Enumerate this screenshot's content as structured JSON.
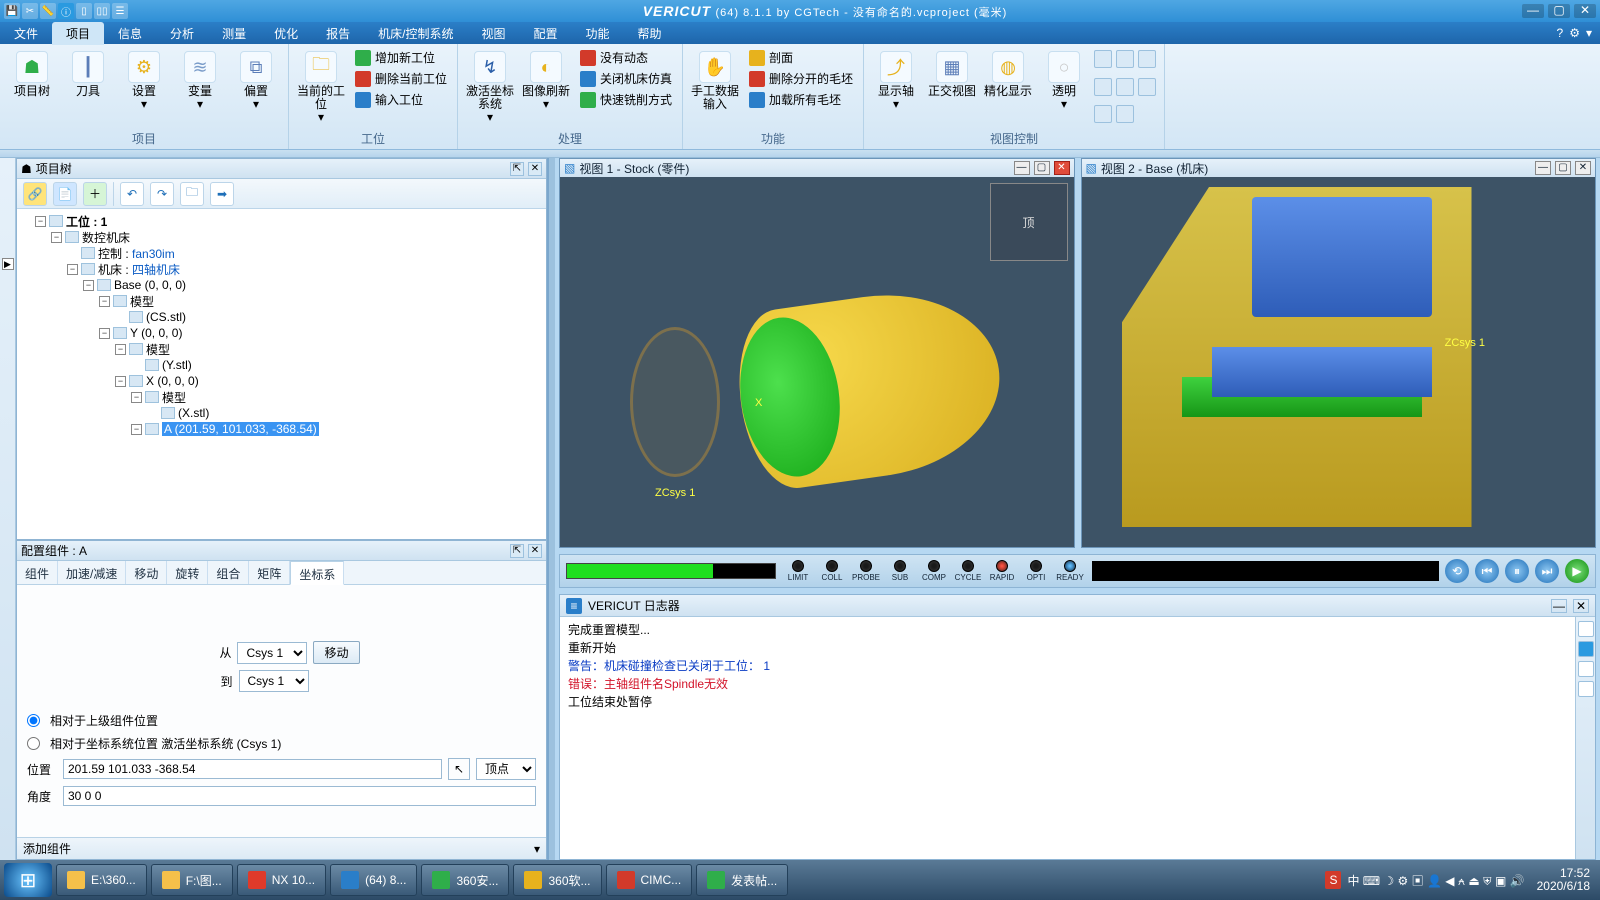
{
  "title": {
    "brand": "VERICUT",
    "suffix": "(64)  8.1.1 by CGTech - 没有命名的.vcproject (毫米)"
  },
  "menus": [
    "文件",
    "项目",
    "信息",
    "分析",
    "测量",
    "优化",
    "报告",
    "机床/控制系统",
    "视图",
    "配置",
    "功能",
    "帮助"
  ],
  "menu_active_index": 1,
  "ribbon": {
    "groups": [
      {
        "label": "项目",
        "big": [
          {
            "name": "project-tree",
            "label": "项目树",
            "icon": "☗",
            "color": "#2fae4a"
          },
          {
            "name": "tool",
            "label": "刀具",
            "icon": "┃",
            "color": "#5b7db8"
          },
          {
            "name": "setup",
            "label": "设置",
            "icon": "⚙",
            "color": "#e7b21d",
            "drop": true
          },
          {
            "name": "variable",
            "label": "变量",
            "icon": "≋",
            "color": "#7a9cc9",
            "drop": true
          },
          {
            "name": "offset",
            "label": "偏置",
            "icon": "⧉",
            "color": "#5b7db8",
            "drop": true
          }
        ]
      },
      {
        "label": "工位",
        "big": [
          {
            "name": "current-setup",
            "label": "当前的工位",
            "icon": "🗀",
            "color": "#e7b21d",
            "drop": true
          }
        ],
        "small": [
          {
            "name": "add-setup",
            "label": "增加新工位",
            "icon": "#2fae4a"
          },
          {
            "name": "del-setup",
            "label": "删除当前工位",
            "icon": "#d23a2a"
          },
          {
            "name": "import-setup",
            "label": "输入工位",
            "icon": "#2a7ec9"
          }
        ]
      },
      {
        "label": "处理",
        "big": [
          {
            "name": "activate-csys",
            "label": "激活坐标系统",
            "icon": "↯",
            "color": "#2a5ea8",
            "drop": true
          },
          {
            "name": "image-refresh",
            "label": "图像刷新",
            "icon": "◐",
            "color": "#e7b21d",
            "drop": true
          }
        ],
        "small": [
          {
            "name": "no-anim",
            "label": "没有动态",
            "icon": "#d23a2a"
          },
          {
            "name": "close-sim",
            "label": "关闭机床仿真",
            "icon": "#2a7ec9"
          },
          {
            "name": "fast-mill",
            "label": "快速铣削方式",
            "icon": "#2fae4a"
          }
        ]
      },
      {
        "label": "功能",
        "big": [
          {
            "name": "manual-input",
            "label": "手工数据输入",
            "icon": "✋",
            "color": "#e08a1d"
          }
        ],
        "small": [
          {
            "name": "section",
            "label": "剖面",
            "icon": "#e7b21d"
          },
          {
            "name": "del-split",
            "label": "删除分开的毛坯",
            "icon": "#d23a2a"
          },
          {
            "name": "load-all",
            "label": "加载所有毛坯",
            "icon": "#2a7ec9"
          }
        ]
      },
      {
        "label": "视图控制",
        "big": [
          {
            "name": "show-axis",
            "label": "显示轴",
            "icon": "⤴",
            "color": "#e7b21d",
            "drop": true
          },
          {
            "name": "ortho",
            "label": "正交视图",
            "icon": "▦",
            "color": "#5b7db8"
          },
          {
            "name": "refine",
            "label": "精化显示",
            "icon": "◍",
            "color": "#e7b21d"
          },
          {
            "name": "transparent",
            "label": "透明",
            "icon": "○",
            "color": "#c8c8c8",
            "drop": true
          }
        ],
        "grid": 8
      }
    ]
  },
  "project_tree": {
    "title": "项目树",
    "nodes": [
      {
        "ind": 1,
        "exp": "−",
        "text": "工位 : 1",
        "bold": true
      },
      {
        "ind": 2,
        "exp": "−",
        "text": "数控机床"
      },
      {
        "ind": 3,
        "exp": "",
        "text": "控制 : ",
        "link": "fan30im"
      },
      {
        "ind": 3,
        "exp": "−",
        "text": "机床 : ",
        "link": "四轴机床"
      },
      {
        "ind": 4,
        "exp": "−",
        "text": "Base (0, 0, 0)"
      },
      {
        "ind": 5,
        "exp": "−",
        "text": "模型"
      },
      {
        "ind": 6,
        "exp": "",
        "text": "(CS.stl)"
      },
      {
        "ind": 5,
        "exp": "−",
        "text": "Y (0, 0, 0)"
      },
      {
        "ind": 6,
        "exp": "−",
        "text": "模型"
      },
      {
        "ind": 7,
        "exp": "",
        "text": "(Y.stl)"
      },
      {
        "ind": 6,
        "exp": "−",
        "text": "X (0, 0, 0)"
      },
      {
        "ind": 7,
        "exp": "−",
        "text": "模型"
      },
      {
        "ind": 8,
        "exp": "",
        "text": "(X.stl)"
      },
      {
        "ind": 7,
        "exp": "−",
        "text": "A (201.59, 101.033, -368.54)",
        "sel": true
      }
    ]
  },
  "config": {
    "title": "配置组件 : A",
    "tabs": [
      "组件",
      "加速/减速",
      "移动",
      "旋转",
      "组合",
      "矩阵",
      "坐标系"
    ],
    "active_tab": 6,
    "from_label": "从",
    "to_label": "到",
    "csys_from": "Csys 1",
    "csys_to": "Csys 1",
    "move_btn": "移动",
    "radio1": "相对于上级组件位置",
    "radio2": "相对于坐标系统位置 激活坐标系统 (Csys 1)",
    "pos_label": "位置",
    "pos_value": "201.59 101.033 -368.54",
    "vertex_label": "顶点",
    "ang_label": "角度",
    "ang_value": "30 0 0",
    "add_label": "添加组件"
  },
  "views": {
    "v1": {
      "title": "视图 1 - Stock (零件)",
      "axis1": "X",
      "axis2": "ZCsys 1",
      "compass": "顶"
    },
    "v2": {
      "title": "视图 2 - Base (机床)",
      "axis": "ZCsys 1"
    }
  },
  "leds": [
    "LIMIT",
    "COLL",
    "PROBE",
    "SUB",
    "COMP",
    "CYCLE",
    "RAPID",
    "OPTI",
    "READY"
  ],
  "log": {
    "title": "VERICUT 日志器",
    "lines": [
      {
        "text": "完成重置模型...",
        "color": "#000"
      },
      {
        "text": "重新开始",
        "color": "#000"
      },
      {
        "text": "警告：机床碰撞检查已关闭于工位： 1",
        "color": "#0a3cc4"
      },
      {
        "text": "错误：主轴组件名Spindle无效",
        "color": "#d2142a"
      },
      {
        "text": "工位结束处暂停",
        "color": "#000"
      }
    ]
  },
  "taskbar": {
    "items": [
      {
        "label": "E:\\360...",
        "color": "#f5c04a"
      },
      {
        "label": "F:\\图...",
        "color": "#f5c04a"
      },
      {
        "label": "NX 10...",
        "color": "#e03a2a"
      },
      {
        "label": "(64)  8...",
        "color": "#2a7ec9"
      },
      {
        "label": "360安...",
        "color": "#2fae4a"
      },
      {
        "label": "360软...",
        "color": "#e7b21d"
      },
      {
        "label": "CIMC...",
        "color": "#d23a2a"
      },
      {
        "label": "发表帖...",
        "color": "#2fae4a"
      }
    ],
    "tray_text": "中 ⌨ ☽ ⚙ ▣ 👤 ◀ ⍲ ⏏ ⛨ ▣ 🔊",
    "time": "17:52",
    "date": "2020/6/18"
  }
}
